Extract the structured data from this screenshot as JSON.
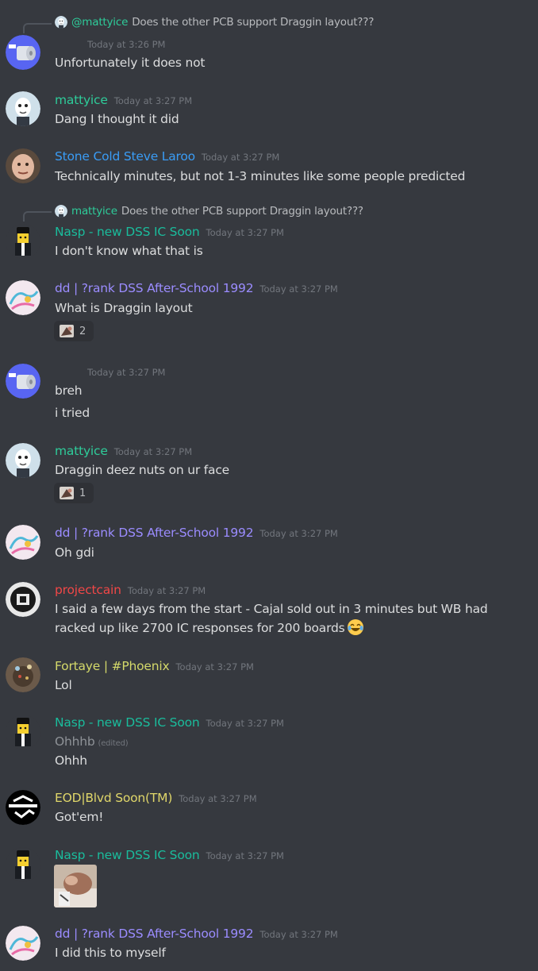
{
  "colors": {
    "background": "#36393f",
    "mattyice": "#2ecc9a",
    "stone_cold": "#3a9cf5",
    "nasp": "#1abc9c",
    "dd": "#9b8cff",
    "projectcain": "#f04747",
    "fortaye": "#d4d96a",
    "eod": "#e0d76a"
  },
  "messages": [
    {
      "reply": {
        "name": "@mattyice",
        "text": "Does the other PCB support Draggin layout???"
      },
      "time": "Today at 3:26 PM",
      "text": "Unfortunately it does not"
    },
    {
      "author": "mattyice",
      "time": "Today at 3:27 PM",
      "text": "Dang I thought it did"
    },
    {
      "author": "Stone Cold Steve Laroo",
      "time": "Today at 3:27 PM",
      "text": "Technically minutes, but not 1-3 minutes like some people predicted"
    },
    {
      "reply": {
        "name": "mattyice",
        "text": "Does the other PCB support Draggin layout???"
      },
      "author": "Nasp - new DSS IC Soon",
      "time": "Today at 3:27 PM",
      "text": "I don't know what that is"
    },
    {
      "author": "dd | ?rank DSS After-School 1992",
      "time": "Today at 3:27 PM",
      "text": "What is Draggin layout",
      "reaction_count": "2"
    },
    {
      "time": "Today at 3:27 PM",
      "text": "breh",
      "text2": "i tried"
    },
    {
      "author": "mattyice",
      "time": "Today at 3:27 PM",
      "text": "Draggin deez nuts on ur face",
      "reaction_count": "1"
    },
    {
      "author": "dd | ?rank DSS After-School 1992",
      "time": "Today at 3:27 PM",
      "text": "Oh gdi"
    },
    {
      "author": "projectcain",
      "time": "Today at 3:27 PM",
      "text": "I said a few days from the start - Cajal sold out in 3 minutes but WB had racked up like 2700 IC responses for 200 boards"
    },
    {
      "author": "Fortaye | #Phoenix",
      "time": "Today at 3:27 PM",
      "text": "Lol"
    },
    {
      "author": "Nasp - new DSS IC Soon",
      "time": "Today at 3:27 PM",
      "text": "Ohhhb",
      "edited": "(edited)",
      "text2": "Ohhh"
    },
    {
      "author": "EOD|Blvd Soon(TM)",
      "time": "Today at 3:27 PM",
      "text": "Got'em!"
    },
    {
      "author": "Nasp - new DSS IC Soon",
      "time": "Today at 3:27 PM"
    },
    {
      "author": "dd | ?rank DSS After-School 1992",
      "time": "Today at 3:27 PM",
      "text": "I did this to myself"
    }
  ]
}
